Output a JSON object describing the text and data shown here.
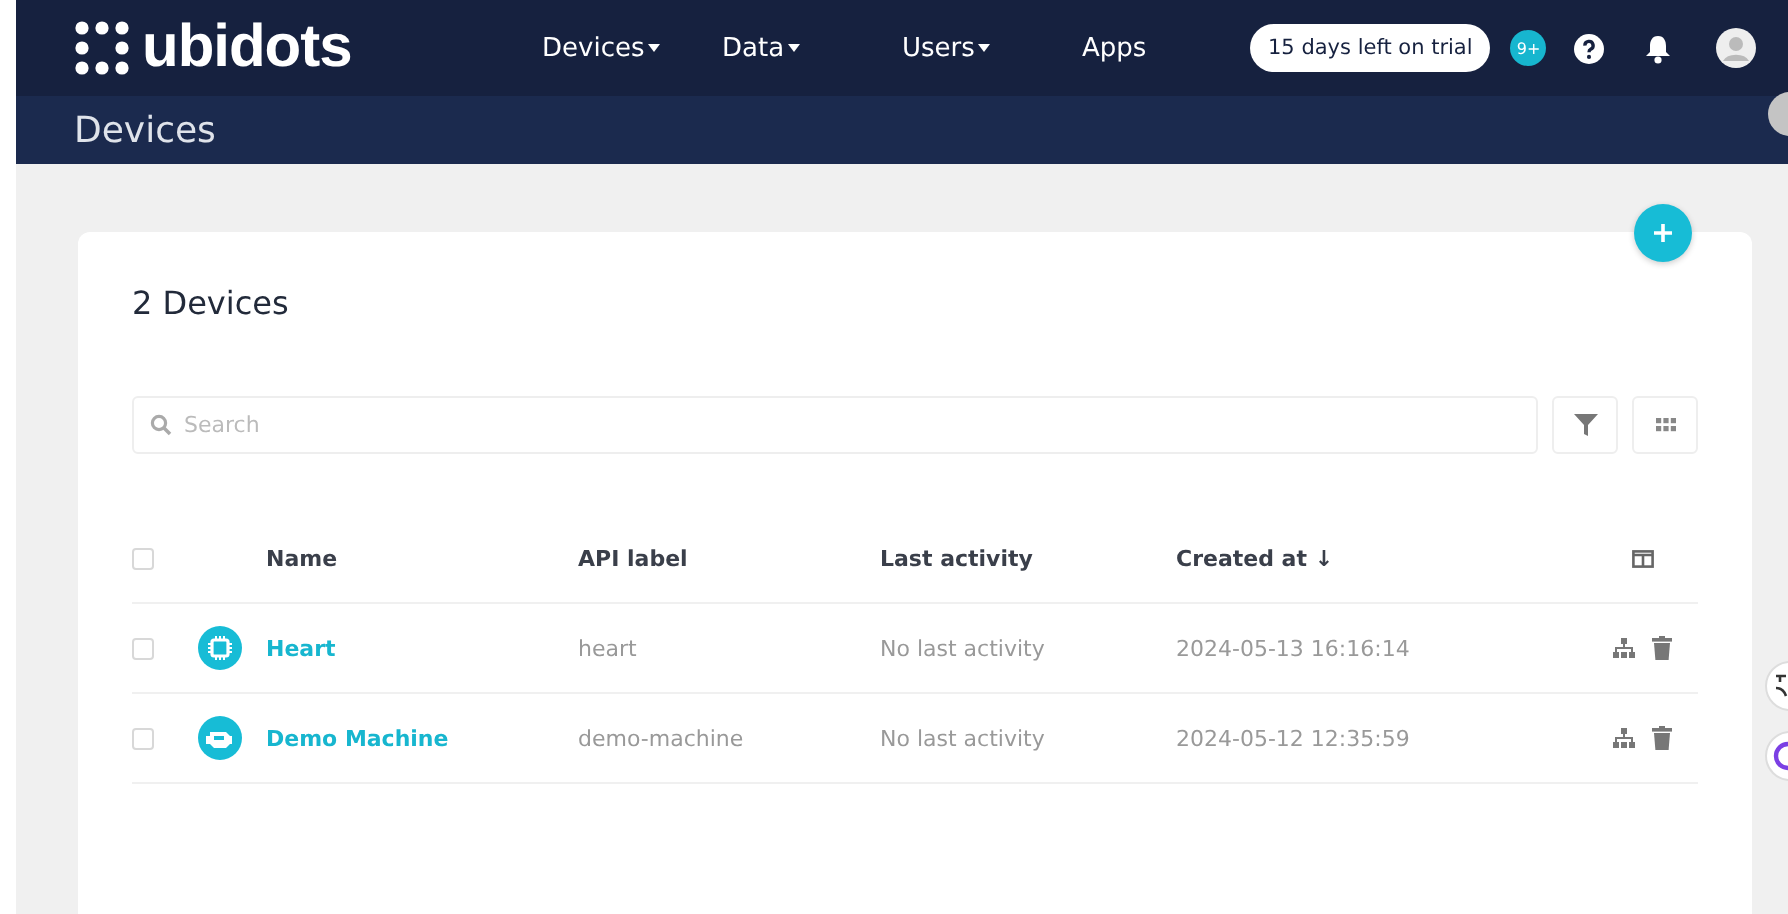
{
  "nav": {
    "logo": "ubidots",
    "menu": [
      {
        "label": "Devices",
        "dropdown": true
      },
      {
        "label": "Data",
        "dropdown": true
      },
      {
        "label": "Users",
        "dropdown": true
      },
      {
        "label": "Apps",
        "dropdown": false
      }
    ],
    "trial": "15 days left on trial",
    "notifications": "9+"
  },
  "page_title": "Devices",
  "card": {
    "heading": "2 Devices",
    "search": {
      "placeholder": "Search"
    },
    "table": {
      "select_all_checked": false,
      "columns": [
        "Name",
        "API label",
        "Last activity",
        "Created at ↓"
      ],
      "rows": [
        {
          "checked": false,
          "kind": "chip",
          "name": "Heart",
          "api_label": "heart",
          "last_activity": "No last activity",
          "created_at": "2024-05-13 16:16:14"
        },
        {
          "checked": false,
          "kind": "engine",
          "name": "Demo Machine",
          "api_label": "demo-machine",
          "last_activity": "No last activity",
          "created_at": "2024-05-12 12:35:59"
        }
      ]
    }
  }
}
